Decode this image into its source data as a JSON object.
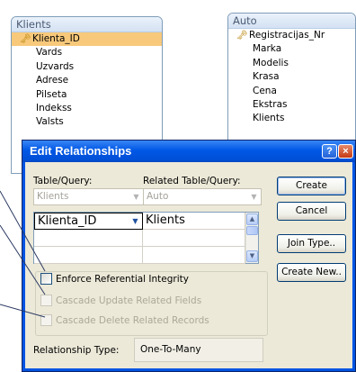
{
  "tables": {
    "klients": {
      "title": "Klients",
      "fields": [
        "Klienta_ID",
        "Vards",
        "Uzvards",
        "Adrese",
        "Pilseta",
        "Indekss",
        "Valsts"
      ]
    },
    "auto": {
      "title": "Auto",
      "fields": [
        "Registracijas_Nr",
        "Marka",
        "Modelis",
        "Krasa",
        "Cena",
        "Ekstras",
        "Klients"
      ]
    }
  },
  "dialog": {
    "title": "Edit Relationships",
    "help_label": "?",
    "close_label": "×",
    "table_query_label": "Table/Query:",
    "related_table_query_label": "Related Table/Query:",
    "table_query_value": "Klients",
    "related_table_query_value": "Auto",
    "grid": {
      "left_value": "Klienta_ID",
      "right_value": "Klients"
    },
    "buttons": {
      "create": "Create",
      "cancel": "Cancel",
      "join_type": "Join Type..",
      "create_new": "Create New.."
    },
    "options": {
      "enforce": "Enforce Referential Integrity",
      "cascade_update": "Cascade Update Related Fields",
      "cascade_delete": "Cascade Delete Related Records"
    },
    "relationship_type_label": "Relationship Type:",
    "relationship_type_value": "One-To-Many"
  }
}
